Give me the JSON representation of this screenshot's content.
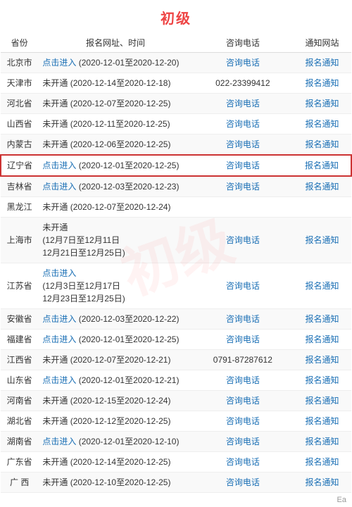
{
  "title": "初级",
  "headers": {
    "province": "省份",
    "register": "报名网址、时间",
    "phone": "咨询电话",
    "notice": "通知网站"
  },
  "rows": [
    {
      "province": "北京市",
      "register_link": "点击进入",
      "register_time": "(2020-12-01至2020-12-20)",
      "phone_link": "咨询电话",
      "notice_link": "报名通知",
      "highlight": false
    },
    {
      "province": "天津市",
      "register_link": "未开通",
      "register_time": "(2020-12-14至2020-12-18)",
      "phone": "022-23399412",
      "notice_link": "报名通知",
      "highlight": false
    },
    {
      "province": "河北省",
      "register_link": "未开通",
      "register_time": "(2020-12-07至2020-12-25)",
      "phone_link": "咨询电话",
      "notice_link": "报名通知",
      "highlight": false
    },
    {
      "province": "山西省",
      "register_link": "未开通",
      "register_time": "(2020-12-11至2020-12-25)",
      "phone_link": "咨询电话",
      "notice_link": "报名通知",
      "highlight": false
    },
    {
      "province": "内蒙古",
      "register_link": "未开通",
      "register_time": "(2020-12-06至2020-12-25)",
      "phone_link": "咨询电话",
      "notice_link": "报名通知",
      "highlight": false
    },
    {
      "province": "辽宁省",
      "register_link": "点击进入",
      "register_time": "(2020-12-01至2020-12-25)",
      "phone_link": "咨询电话",
      "notice_link": "报名通知",
      "highlight": true
    },
    {
      "province": "吉林省",
      "register_link": "点击进入",
      "register_time": "(2020-12-03至2020-12-23)",
      "phone_link": "咨询电话",
      "notice_link": "报名通知",
      "highlight": false
    },
    {
      "province": "黑龙江",
      "register_link": "未开通",
      "register_time": "(2020-12-07至2020-12-24)",
      "phone_link": "",
      "notice_link": "",
      "highlight": false
    },
    {
      "province": "上海市",
      "register_link": "未开通",
      "register_time": "(12月7日至12月11日\n12月21日至12月25日)",
      "phone_link": "咨询电话",
      "notice_link": "报名通知",
      "highlight": false,
      "multiline": true
    },
    {
      "province": "江苏省",
      "register_link": "点击进入",
      "register_time": "(12月3日至12月17日\n12月23日至12月25日)",
      "phone_link": "咨询电话",
      "notice_link": "报名通知",
      "highlight": false,
      "multiline": true
    },
    {
      "province": "安徽省",
      "register_link": "点击进入",
      "register_time": "(2020-12-03至2020-12-22)",
      "phone_link": "咨询电话",
      "notice_link": "报名通知",
      "highlight": false
    },
    {
      "province": "福建省",
      "register_link": "点击进入",
      "register_time": "(2020-12-01至2020-12-25)",
      "phone_link": "咨询电话",
      "notice_link": "报名通知",
      "highlight": false
    },
    {
      "province": "江西省",
      "register_link": "未开通",
      "register_time": "(2020-12-07至2020-12-21)",
      "phone": "0791-87287612",
      "notice_link": "报名通知",
      "highlight": false
    },
    {
      "province": "山东省",
      "register_link": "点击进入",
      "register_time": "(2020-12-01至2020-12-21)",
      "phone_link": "咨询电话",
      "notice_link": "报名通知",
      "highlight": false
    },
    {
      "province": "河南省",
      "register_link": "未开通",
      "register_time": "(2020-12-15至2020-12-24)",
      "phone_link": "咨询电话",
      "notice_link": "报名通知",
      "highlight": false
    },
    {
      "province": "湖北省",
      "register_link": "未开通",
      "register_time": "(2020-12-12至2020-12-25)",
      "phone_link": "咨询电话",
      "notice_link": "报名通知",
      "highlight": false
    },
    {
      "province": "湖南省",
      "register_link": "点击进入",
      "register_time": "(2020-12-01至2020-12-10)",
      "phone_link": "咨询电话",
      "notice_link": "报名通知",
      "highlight": false
    },
    {
      "province": "广东省",
      "register_link": "未开通",
      "register_time": "(2020-12-14至2020-12-25)",
      "phone_link": "咨询电话",
      "notice_link": "报名通知",
      "highlight": false
    },
    {
      "province": "广 西",
      "register_link": "未开通",
      "register_time": "(2020-12-10至2020-12-25)",
      "phone_link": "咨询电话",
      "notice_link": "报名通知",
      "highlight": false
    }
  ],
  "bottom_note": "Ea"
}
